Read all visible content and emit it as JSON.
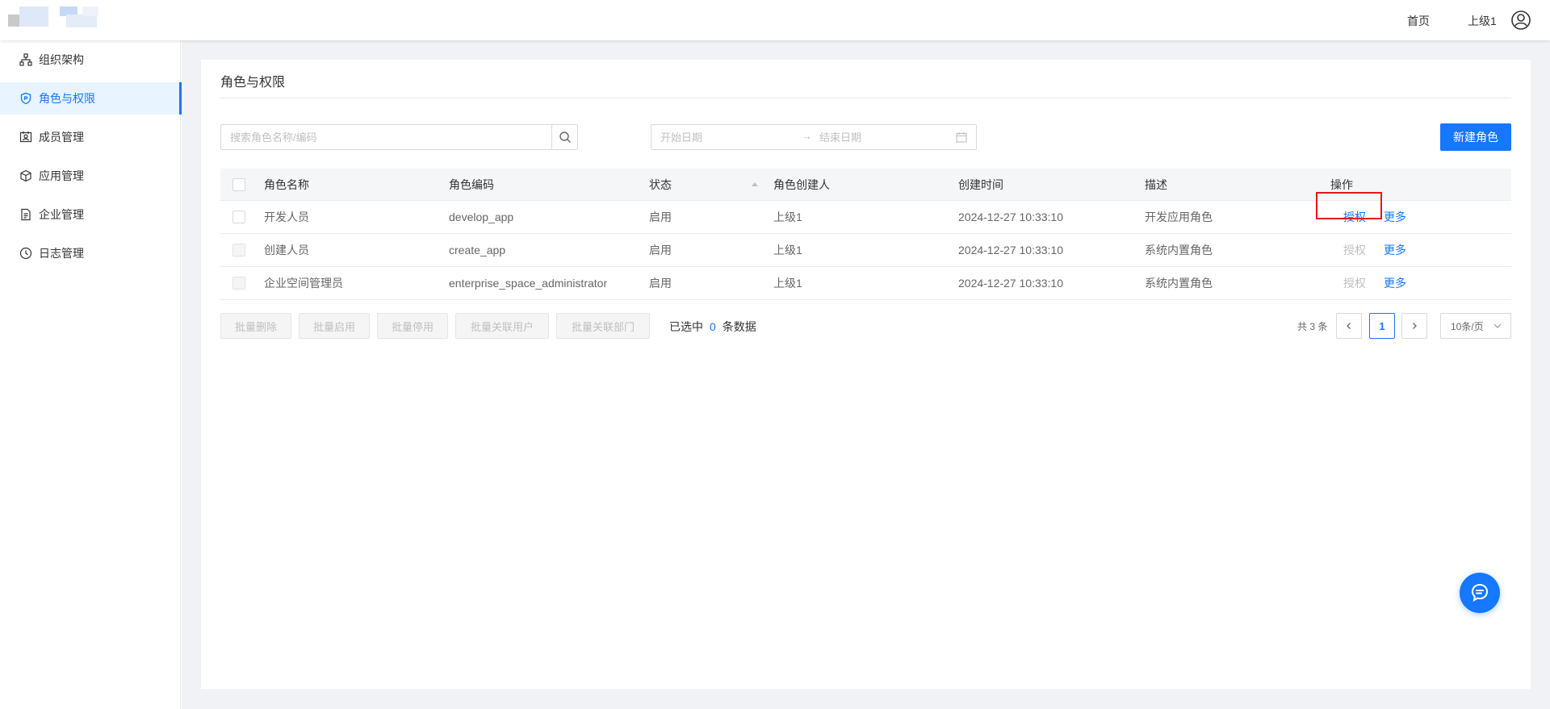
{
  "header": {
    "home_label": "首页",
    "user_name": "上级1",
    "avatar_icon": "user-circle-icon"
  },
  "sidebar": {
    "items": [
      {
        "label": "组织架构",
        "icon": "org-chart-icon",
        "active": false
      },
      {
        "label": "角色与权限",
        "icon": "shield-icon",
        "active": true
      },
      {
        "label": "成员管理",
        "icon": "member-card-icon",
        "active": false
      },
      {
        "label": "应用管理",
        "icon": "cube-icon",
        "active": false
      },
      {
        "label": "企业管理",
        "icon": "document-icon",
        "active": false
      },
      {
        "label": "日志管理",
        "icon": "clock-icon",
        "active": false
      }
    ]
  },
  "main": {
    "title": "角色与权限",
    "search": {
      "placeholder": "搜索角色名称/编码",
      "value": ""
    },
    "date_range": {
      "start_placeholder": "开始日期",
      "end_placeholder": "结束日期",
      "separator": "→"
    },
    "new_button": "新建角色",
    "table": {
      "columns": [
        "角色名称",
        "角色编码",
        "状态",
        "角色创建人",
        "创建时间",
        "描述",
        "操作"
      ],
      "rows": [
        {
          "name": "开发人员",
          "code": "develop_app",
          "status": "启用",
          "creator": "上级1",
          "created_at": "2024-12-27 10:33:10",
          "desc": "开发应用角色",
          "auth": "授权",
          "more": "更多",
          "auth_enabled": true
        },
        {
          "name": "创建人员",
          "code": "create_app",
          "status": "启用",
          "creator": "上级1",
          "created_at": "2024-12-27 10:33:10",
          "desc": "系统内置角色",
          "auth": "授权",
          "more": "更多",
          "auth_enabled": false
        },
        {
          "name": "企业空间管理员",
          "code": "enterprise_space_administrator",
          "status": "启用",
          "creator": "上级1",
          "created_at": "2024-12-27 10:33:10",
          "desc": "系统内置角色",
          "auth": "授权",
          "more": "更多",
          "auth_enabled": false
        }
      ]
    },
    "batch": {
      "delete": "批量删除",
      "enable": "批量启用",
      "disable": "批量停用",
      "link_users": "批量关联用户",
      "link_depts": "批量关联部门"
    },
    "selection": {
      "prefix": "已选中",
      "count": "0",
      "suffix": "条数据"
    },
    "pagination": {
      "total": "共 3 条",
      "current_page": "1",
      "page_size": "10条/页"
    }
  },
  "colors": {
    "accent": "#1677ff",
    "highlight": "#e8161d",
    "sidebar_active_bg": "#e8f4ff"
  }
}
